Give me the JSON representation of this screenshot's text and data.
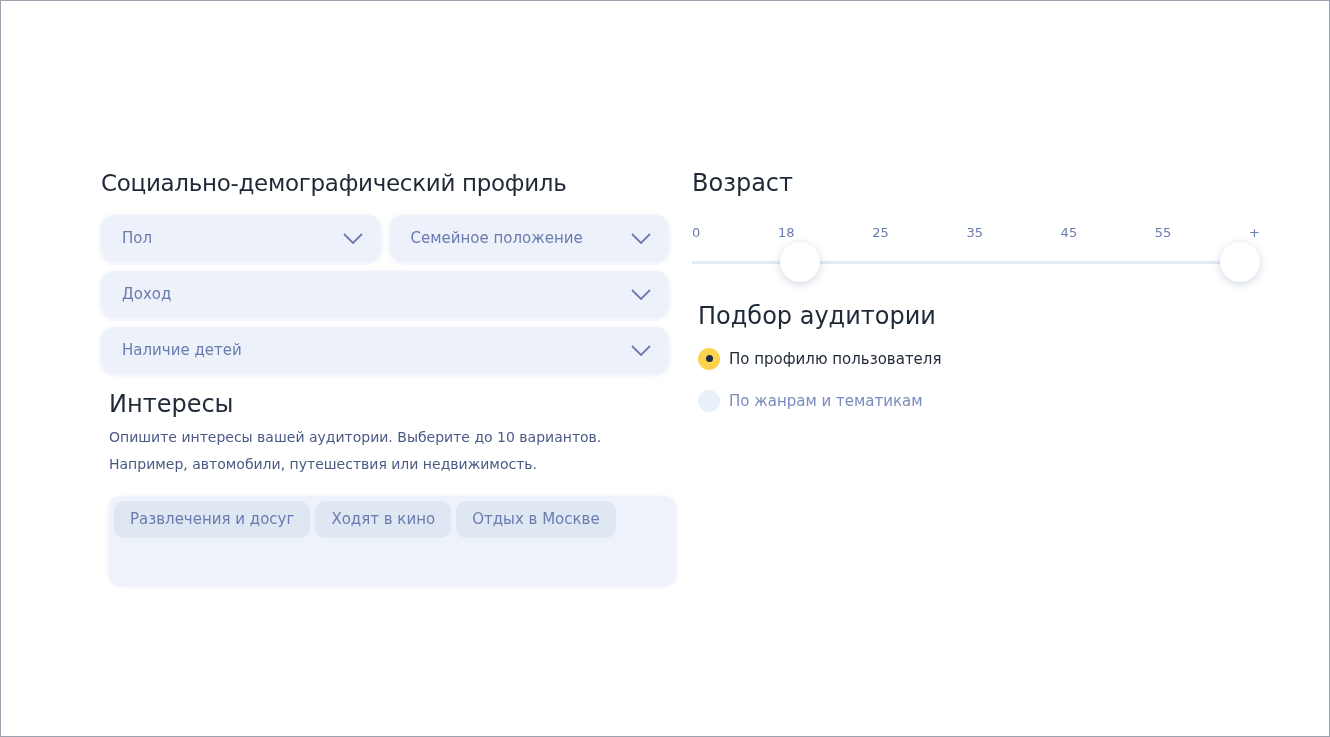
{
  "profile": {
    "title": "Социально-демографический профиль",
    "select_rows": [
      [
        {
          "placeholder": "Пол"
        },
        {
          "placeholder": "Семейное положение"
        }
      ],
      [
        {
          "placeholder": "Доход"
        }
      ],
      [
        {
          "placeholder": "Наличие детей"
        }
      ]
    ]
  },
  "interests": {
    "title": "Интересы",
    "description": "Опишите интересы вашей аудитории. Выберите до 10 вариантов. Например, автомобили, путешествия или недвижимость.",
    "tags": [
      "Развлечения и досуг",
      "Ходят в кино",
      "Отдых в Москве"
    ]
  },
  "age": {
    "title": "Возраст",
    "ticks": [
      "0",
      "18",
      "25",
      "35",
      "45",
      "55",
      "+"
    ],
    "thumbs": [
      {
        "level": 0.19
      },
      {
        "level": 0.965
      }
    ]
  },
  "audience": {
    "title": "Подбор аудитории",
    "options": [
      {
        "label": "По профилю пользователя",
        "selected": true
      },
      {
        "label": "По жанрам и тематикам",
        "selected": false
      }
    ]
  }
}
